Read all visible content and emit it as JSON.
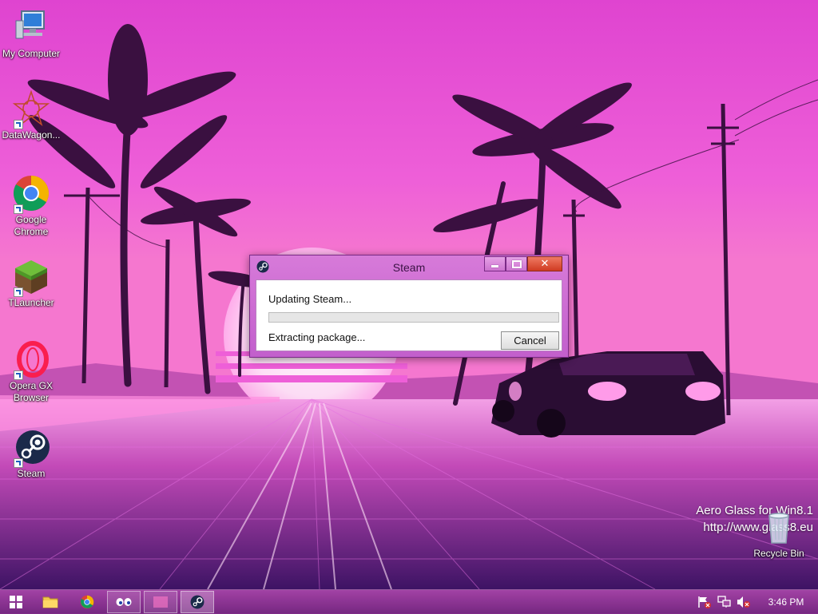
{
  "desktop": {
    "icons": [
      {
        "label": "My Computer"
      },
      {
        "label": "DataWagon..."
      },
      {
        "label": "Google Chrome"
      },
      {
        "label": "TLauncher"
      },
      {
        "label": "Opera GX Browser"
      },
      {
        "label": "Steam"
      }
    ],
    "recycle_bin": {
      "label": "Recycle Bin"
    },
    "watermark": {
      "line1": "Aero Glass for Win8.1",
      "line2": "http://www.glass8.eu"
    }
  },
  "dialog": {
    "title": "Steam",
    "status_line1": "Updating Steam...",
    "status_line2": "Extracting package...",
    "progress_fraction": 0.0,
    "cancel_label": "Cancel"
  },
  "taskbar": {
    "clock": "3:46 PM",
    "items": [
      "start-icon",
      "file-explorer-icon",
      "chrome-icon",
      "eyes-app-icon",
      "blank-app-icon",
      "steam-icon"
    ],
    "tray": [
      "action-center-flag-icon",
      "network-icon",
      "volume-muted-icon"
    ]
  },
  "colors": {
    "accent": "#c25fcc",
    "close_button": "#cf3b22",
    "progress_fill": "#06b025"
  }
}
